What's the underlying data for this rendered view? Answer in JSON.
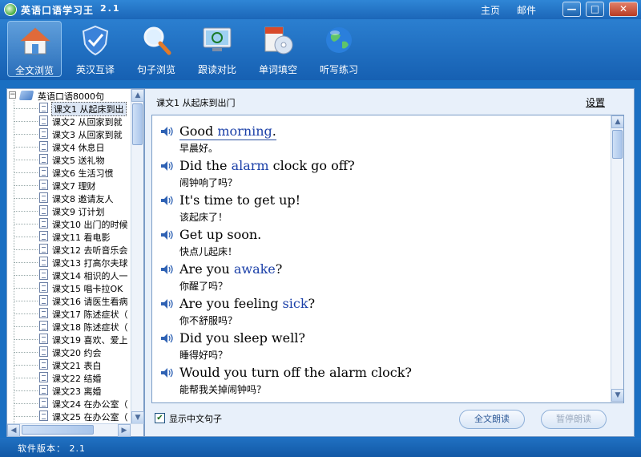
{
  "app": {
    "title": "英语口语学习王",
    "version": "2.1",
    "accent_color": "#1a6fc2"
  },
  "titlebar": {
    "links": [
      {
        "label": "主页"
      },
      {
        "label": "邮件"
      }
    ],
    "window_controls": [
      {
        "icon": "minimize-icon",
        "glyph": "—"
      },
      {
        "icon": "maximize-icon",
        "glyph": "□"
      },
      {
        "icon": "close-icon",
        "glyph": "✕"
      }
    ]
  },
  "toolbar": {
    "items": [
      {
        "label": "全文浏览",
        "icon": "home-icon",
        "active": true
      },
      {
        "label": "英汉互译",
        "icon": "shield-icon",
        "active": false
      },
      {
        "label": "句子浏览",
        "icon": "magnifier-icon",
        "active": false
      },
      {
        "label": "跟读对比",
        "icon": "recycle-monitor-icon",
        "active": false
      },
      {
        "label": "单词填空",
        "icon": "disc-icon",
        "active": false
      },
      {
        "label": "听写练习",
        "icon": "globe-icon",
        "active": false
      }
    ]
  },
  "tree": {
    "root_label": "英语口语8000句",
    "items": [
      {
        "label": "课文1  从起床到出",
        "selected": true
      },
      {
        "label": "课文2  从回家到就",
        "selected": false
      },
      {
        "label": "课文3  从回家到就",
        "selected": false
      },
      {
        "label": "课文4  休息日",
        "selected": false
      },
      {
        "label": "课文5  送礼物",
        "selected": false
      },
      {
        "label": "课文6  生活习惯",
        "selected": false
      },
      {
        "label": "课文7  理财",
        "selected": false
      },
      {
        "label": "课文8  邀请友人",
        "selected": false
      },
      {
        "label": "课文9  订计划",
        "selected": false
      },
      {
        "label": "课文10  出门的时候",
        "selected": false
      },
      {
        "label": "课文11  看电影",
        "selected": false
      },
      {
        "label": "课文12  去听音乐会",
        "selected": false
      },
      {
        "label": "课文13  打高尔夫球",
        "selected": false
      },
      {
        "label": "课文14  相识的人一",
        "selected": false
      },
      {
        "label": "课文15  唱卡拉OK",
        "selected": false
      },
      {
        "label": "课文16  请医生看病",
        "selected": false
      },
      {
        "label": "课文17  陈述症状（",
        "selected": false
      },
      {
        "label": "课文18  陈述症状（",
        "selected": false
      },
      {
        "label": "课文19  喜欢、爱上",
        "selected": false
      },
      {
        "label": "课文20  约会",
        "selected": false
      },
      {
        "label": "课文21  表白",
        "selected": false
      },
      {
        "label": "课文22  结婚",
        "selected": false
      },
      {
        "label": "课文23  离婚",
        "selected": false
      },
      {
        "label": "课文24  在办公室（",
        "selected": false
      },
      {
        "label": "课文25  在办公室（",
        "selected": false
      }
    ]
  },
  "main": {
    "lesson_title": "课文1  从起床到出门",
    "settings_label": "设置",
    "sentences": [
      {
        "en_parts": [
          {
            "text": "Good ",
            "kw": false
          },
          {
            "text": "morning",
            "kw": true
          },
          {
            "text": ".",
            "kw": false
          }
        ],
        "cn": "早晨好。",
        "underlined": true
      },
      {
        "en_parts": [
          {
            "text": "Did the ",
            "kw": false
          },
          {
            "text": "alarm",
            "kw": true
          },
          {
            "text": " clock go off?",
            "kw": false
          }
        ],
        "cn": "闹钟响了吗？",
        "underlined": false
      },
      {
        "en_parts": [
          {
            "text": "It's time to get up!",
            "kw": false
          }
        ],
        "cn": "该起床了！",
        "underlined": false
      },
      {
        "en_parts": [
          {
            "text": "Get up soon.",
            "kw": false
          }
        ],
        "cn": "快点儿起床！",
        "underlined": false
      },
      {
        "en_parts": [
          {
            "text": "Are you ",
            "kw": false
          },
          {
            "text": "awake",
            "kw": true
          },
          {
            "text": "?",
            "kw": false
          }
        ],
        "cn": "你醒了吗？",
        "underlined": false
      },
      {
        "en_parts": [
          {
            "text": "Are you feeling ",
            "kw": false
          },
          {
            "text": "sick",
            "kw": true
          },
          {
            "text": "?",
            "kw": false
          }
        ],
        "cn": "你不舒服吗？",
        "underlined": false
      },
      {
        "en_parts": [
          {
            "text": "Did you sleep well?",
            "kw": false
          }
        ],
        "cn": "睡得好吗？",
        "underlined": false
      },
      {
        "en_parts": [
          {
            "text": "Would you turn off the alarm clock?",
            "kw": false
          }
        ],
        "cn": "能帮我关掉闹钟吗？",
        "underlined": false
      }
    ],
    "show_chinese_label": "显示中文句子",
    "show_chinese_checked": true,
    "read_all_label": "全文朗读",
    "pause_label": "暂停朗读",
    "keyword_color": "#1a3fa8"
  },
  "statusbar": {
    "text": "软件版本：  2.1"
  }
}
